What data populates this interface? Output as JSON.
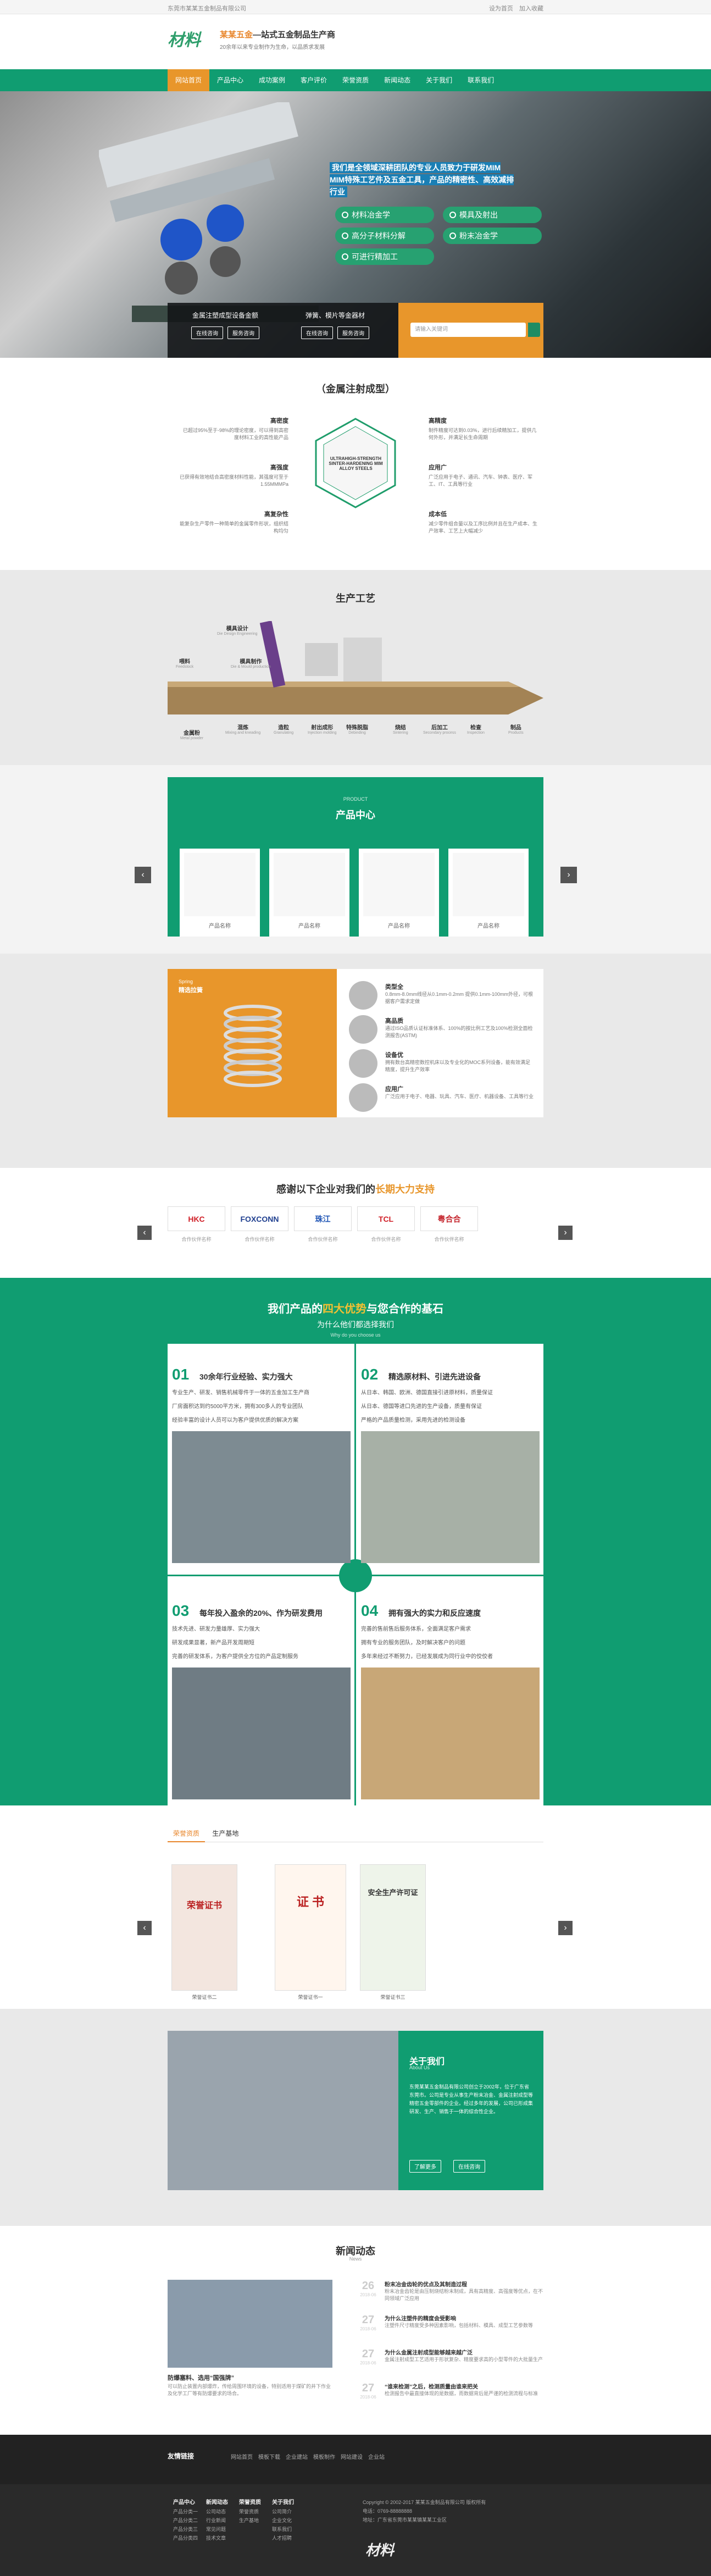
{
  "topbar": {
    "left": "东莞市某某五金制品有限公司",
    "links": [
      "设为首页",
      "加入收藏"
    ]
  },
  "brand": {
    "logo": "材料",
    "title_hl": "某某五金",
    "title": "—站式五金制品生产商",
    "sub": "20余年以来专业制作为生命，以品质求发展"
  },
  "nav": [
    "网站首页",
    "产品中心",
    "成功案例",
    "客户评价",
    "荣誉资质",
    "新闻动态",
    "关于我们",
    "联系我们"
  ],
  "hero": {
    "blurb": "我们是全领域深耕团队的专业人员致力于研发MIM MIM特殊工艺件及五金工具，产品的精密性、高效减排行业",
    "feats": [
      "材料冶金学",
      "模具及射出",
      "高分子材料分解",
      "粉末冶金学",
      "可进行精加工"
    ],
    "bar_cells": [
      {
        "title": "金属注塑成型设备金额",
        "btns": [
          "在线咨询",
          "服务咨询"
        ]
      },
      {
        "title": "弹簧、模片等金器材",
        "btns": [
          "在线咨询",
          "服务咨询"
        ]
      }
    ],
    "search_ph": "请输入关键词"
  },
  "mim": {
    "title": "（金属注射成型）",
    "hex_text": "ULTRAHIGH-STRENGTH SINTER-HARDENING MIM ALLOY STEELS",
    "blocks": [
      {
        "h": "高密度",
        "p": "已超过95%至于-98%的理论密度，可以得到高密度材料工业的高性能产品"
      },
      {
        "h": "高精度",
        "p": "制件精度可达到0.03%，进行后续精加工，提供几何外形，并满足长生命周期"
      },
      {
        "h": "高强度",
        "p": "已获得有效地结合高密度材料性能，其强度可至于1.55MMMPa"
      },
      {
        "h": "应用广",
        "p": "广泛应用于电子、通讯、汽车、钟表、医疗、军工、IT、工具等行业"
      },
      {
        "h": "高复杂性",
        "p": "能复杂生产零件一种简单的金属零件形状，组织结构均匀"
      },
      {
        "h": "成本低",
        "p": "减少零件组合量以及工序比例并且在生产成本、生产效率、工艺上大幅减少"
      }
    ]
  },
  "process": {
    "title": "生产工艺",
    "steps": [
      {
        "n": "模具设计",
        "e": "Die Design Engineering"
      },
      {
        "n": "喂料",
        "e": "Feedstock"
      },
      {
        "n": "模具制作",
        "e": "Die & Mould production"
      },
      {
        "n": "金属粉",
        "e": "Metal powder"
      },
      {
        "n": "混炼",
        "e": "Mixing and kneading"
      },
      {
        "n": "造粒",
        "e": "Granulating"
      },
      {
        "n": "射出成形",
        "e": "Injection molding"
      },
      {
        "n": "特殊脱脂",
        "e": "Debinding"
      },
      {
        "n": "烧结",
        "e": "Sintering"
      },
      {
        "n": "后加工",
        "e": "Secondary process"
      },
      {
        "n": "检查",
        "e": "Inspection"
      },
      {
        "n": "制品",
        "e": "Products"
      }
    ]
  },
  "products": {
    "sub": "PRODUCT",
    "title": "产品中心",
    "items": [
      "产品名称",
      "产品名称",
      "产品名称",
      "产品名称"
    ]
  },
  "feature": {
    "badge": "Spring",
    "tag": "精选拉簧",
    "rows": [
      {
        "h": "类型全",
        "p": "0.8mm-8.0mm线径从0.1mm-0.2mm 提供0.1mm-100mm外径，可根据客户需求定做"
      },
      {
        "h": "高品质",
        "p": "通过ISO品质认证标准体系、100%的按比例工艺及100%检测全面检测报告(ASTM)"
      },
      {
        "h": "设备优",
        "p": "拥有数台高精密数控机床以及专业化的MOC系列设备，能有效满足精度，提升生产效率"
      },
      {
        "h": "应用广",
        "p": "广泛应用于电子、电器、玩具、汽车、医疗、机器设备、工具等行业"
      }
    ]
  },
  "partners": {
    "title_pre": "感谢以下企业对我们的",
    "title_hl": "长期大力支持",
    "logos": [
      {
        "n": "HKC",
        "c": "#d01f27"
      },
      {
        "n": "FOXCONN",
        "c": "#1f3f8f"
      },
      {
        "n": "珠江",
        "c": "#1f55b5"
      },
      {
        "n": "TCL",
        "c": "#d01f27"
      },
      {
        "n": "粤合合",
        "c": "#c4232b"
      }
    ],
    "caps": [
      "合作伙伴名称",
      "合作伙伴名称",
      "合作伙伴名称",
      "合作伙伴名称",
      "合作伙伴名称"
    ]
  },
  "advantages": {
    "t1_pre": "我们产品的",
    "t1_hl": "四大优势",
    "t1_post": "与您合作的基石",
    "t2": "为什么他们都选择我们",
    "t3": "Why do you choose us",
    "items": [
      {
        "n": "01",
        "h": "30余年行业经验、实力强大",
        "lines": [
          "专业生产、研发、销售机械零件于一体的五金加工生产商",
          "厂房面积达到约5000平方米，拥有300多人的专业团队",
          "经验丰富的设计人员可以为客户提供优质的解决方案"
        ]
      },
      {
        "n": "02",
        "h": "精选原材料、引进先进设备",
        "lines": [
          "从日本、韩国、欧洲、德国直接引进原材料，质量保证",
          "从日本、德国等进口先进的生产设备，质量有保证",
          "严格的产品质量检测，采用先进的检测设备"
        ]
      },
      {
        "n": "03",
        "h": "每年投入盈余的20%、作为研发费用",
        "lines": [
          "技术先进、研发力量雄厚、实力强大",
          "研发成果显著，新产品开发周期短",
          "完善的研发体系，为客户提供全方位的产品定制服务"
        ]
      },
      {
        "n": "04",
        "h": "拥有强大的实力和反应速度",
        "lines": [
          "完善的售前售后服务体系，全面满足客户需求",
          "拥有专业的服务团队，及时解决客户的问题",
          "多年来经过不断努力，已经发展成为同行业中的佼佼者"
        ]
      }
    ]
  },
  "certs": {
    "tabs": [
      "荣誉资质",
      "生产基地"
    ],
    "caps": [
      "荣誉证书二",
      "荣誉证书一",
      "荣誉证书三"
    ],
    "cert_texts": [
      "荣誉证书",
      "证 书",
      "安全生产许可证"
    ]
  },
  "about": {
    "title": "关于我们",
    "sub": "About Us",
    "text": "东莞某某五金制品有限公司创立于2002年，位于广东省东莞市。公司是专业从事生产粉末冶金、金属注射成型等精密五金零部件的企业。经过多年的发展，公司已形成集研发、生产、销售于一体的综合性企业。",
    "btns": [
      "了解更多",
      "在线咨询"
    ]
  },
  "news": {
    "title": "新闻动态",
    "sub": "News",
    "feat_title": "防爆塞料、选用“国强牌”",
    "feat_text": "可以防止装置内部爆炸，传给周围环境的设备，特别适用于煤矿的井下作业及化学工厂等有防爆要求的场合。",
    "items": [
      {
        "d": "26",
        "m": "2018-06",
        "h": "粉末冶金齿轮的优点及其制造过程",
        "p": "粉末冶金齿轮是由压制烧结粉末制成，具有高精度、高强度等优点，在不同领域广泛应用"
      },
      {
        "d": "27",
        "m": "2018-06",
        "h": "为什么注塑件的精度会受影响",
        "p": "注塑件尺寸精度受多种因素影响，包括材料、模具、成型工艺参数等"
      },
      {
        "d": "27",
        "m": "2018-06",
        "h": "为什么金属注射成型能够越来越广泛",
        "p": "金属注射成型工艺适用于形状复杂、精度要求高的小型零件的大批量生产"
      },
      {
        "d": "27",
        "m": "2018-06",
        "h": "“谁来检测”之后，检测质量由谁来把关",
        "p": "检测报告中最直接体现的是数据，而数据背后是严谨的检测流程与标准"
      }
    ]
  },
  "flinks": {
    "label": "友情链接",
    "links": [
      "网站首页",
      "模板下载",
      "企业建站",
      "模板制作",
      "网站建设",
      "企业站"
    ]
  },
  "footer": {
    "cols": [
      {
        "h": "产品中心",
        "items": [
          "产品分类一",
          "产品分类二",
          "产品分类三",
          "产品分类四"
        ]
      },
      {
        "h": "新闻动态",
        "items": [
          "公司动态",
          "行业新闻",
          "常见问题",
          "技术文章"
        ]
      },
      {
        "h": "荣誉资质",
        "items": [
          "荣誉资质",
          "生产基地"
        ]
      },
      {
        "h": "关于我们",
        "items": [
          "公司简介",
          "企业文化",
          "联系我们",
          "人才招聘"
        ]
      }
    ],
    "copy": "Copyright © 2002-2017 某某五金制品有限公司 版权所有",
    "tel": "电话：0769-88888888",
    "addr": "地址：广东省东莞市某某镇某某工业区"
  }
}
